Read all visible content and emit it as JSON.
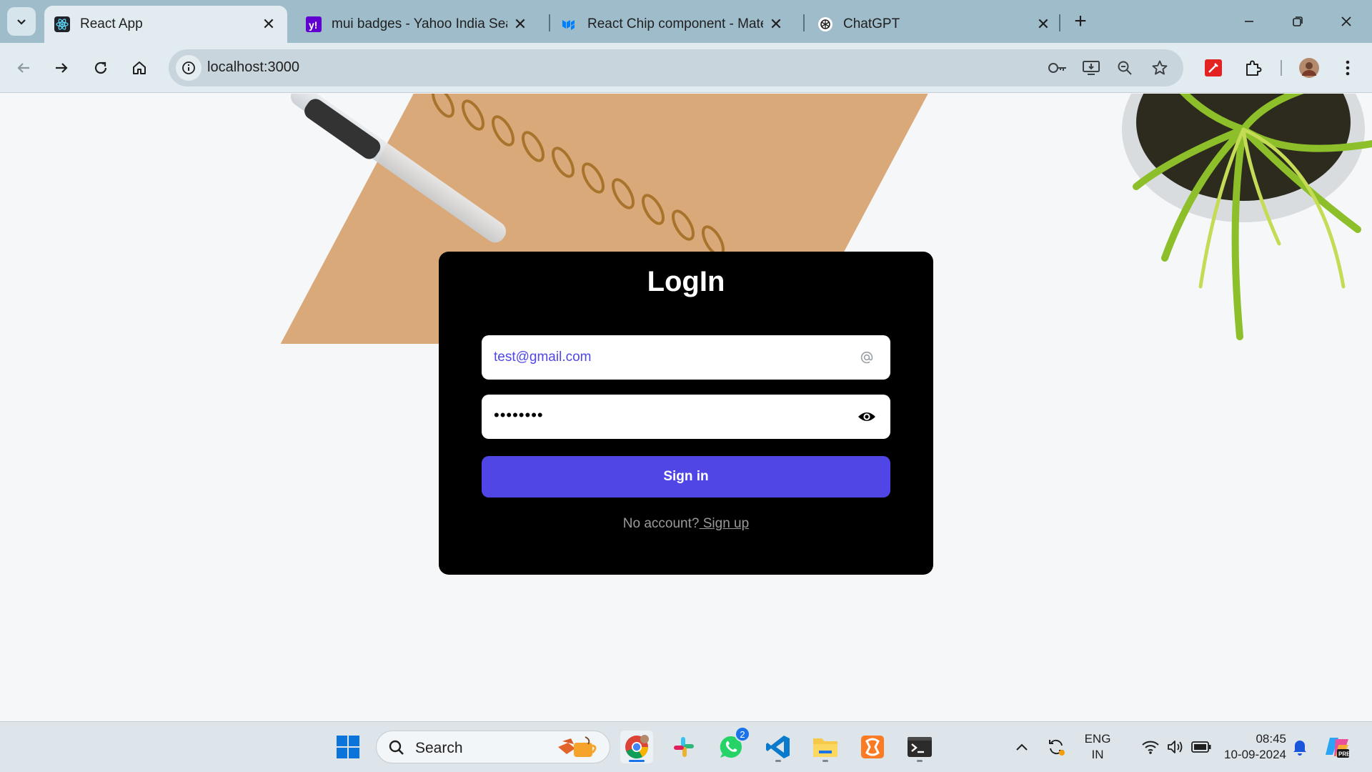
{
  "browser": {
    "tabs": [
      {
        "title": "React App",
        "icon": "react-icon",
        "active": true
      },
      {
        "title": "mui badges - Yahoo India Search",
        "icon": "yahoo-icon",
        "active": false
      },
      {
        "title": "React Chip component - Material UI",
        "icon": "mui-icon",
        "active": false
      },
      {
        "title": "ChatGPT",
        "icon": "chatgpt-icon",
        "active": false
      }
    ],
    "url": "localhost:3000"
  },
  "login": {
    "title": "LogIn",
    "email_value": "test@gmail.com",
    "password_mask": "••••••••",
    "signin_label": "Sign in",
    "no_account_text": "No account?",
    "signup_link": " Sign up"
  },
  "taskbar": {
    "search_label": "Search",
    "whatsapp_badge": "2",
    "lang_line1": "ENG",
    "lang_line2": "IN",
    "time": "08:45",
    "date": "10-09-2024"
  },
  "colors": {
    "accent": "#4f46e5",
    "card": "#000000",
    "email_text": "#4f46e5"
  }
}
